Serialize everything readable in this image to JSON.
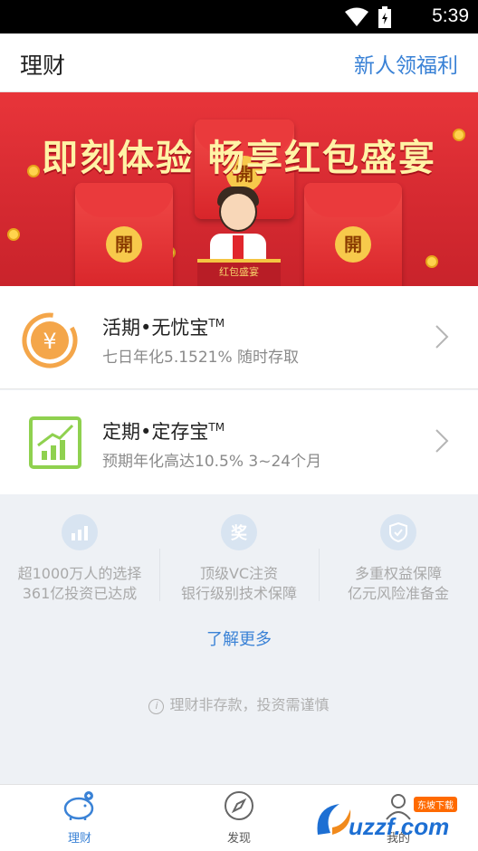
{
  "status_bar": {
    "time": "5:39",
    "icons": [
      "wifi-icon",
      "battery-icon"
    ]
  },
  "header": {
    "title": "理财",
    "promo_link": "新人领福利"
  },
  "banner": {
    "headline": "即刻体验 畅享红包盛宴",
    "envelope_char": "開",
    "box_text": "红包盛宴"
  },
  "products": [
    {
      "name": "活期•无忧宝",
      "tm": "TM",
      "desc": "七日年化5.1521% 随时存取",
      "icon": "yuan-icon"
    },
    {
      "name": "定期•定存宝",
      "tm": "TM",
      "desc": "预期年化高达10.5% 3~24个月",
      "icon": "growth-chart-icon"
    }
  ],
  "features": [
    {
      "icon": "bar-chart-icon",
      "line1": "超1000万人的选择",
      "line2": "361亿投资已达成"
    },
    {
      "icon": "award-icon",
      "icon_char": "奖",
      "line1": "顶级VC注资",
      "line2": "银行级别技术保障"
    },
    {
      "icon": "shield-icon",
      "line1": "多重权益保障",
      "line2": "亿元风险准备金"
    }
  ],
  "learn_more": "了解更多",
  "disclaimer": "理财非存款，投资需谨慎",
  "tabs": [
    {
      "label": "理财",
      "icon": "piggy-bank-icon",
      "active": true
    },
    {
      "label": "发现",
      "icon": "compass-icon",
      "active": false
    },
    {
      "label": "我的",
      "icon": "user-icon",
      "active": false
    }
  ],
  "watermark": {
    "text": "uzzf.com",
    "sub": "东坡下载"
  },
  "colors": {
    "accent": "#3a82d6",
    "banner_red": "#d62a31",
    "text_primary": "#222222",
    "text_secondary": "#8a8a8a"
  }
}
